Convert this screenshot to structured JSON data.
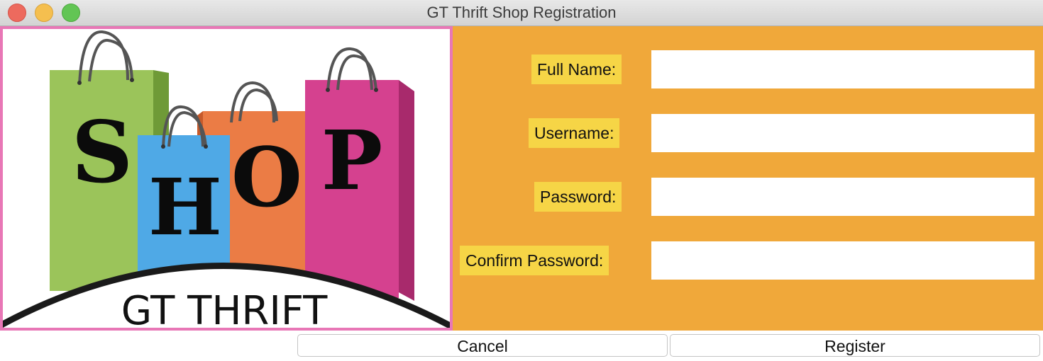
{
  "window": {
    "title": "GT Thrift Shop Registration"
  },
  "logo": {
    "bag_letters": [
      "S",
      "H",
      "O",
      "P"
    ],
    "caption": "GT THRIFT",
    "colors": {
      "border": "#e877b6",
      "bag_green": "#9bc45a",
      "bag_blue": "#4fa9e6",
      "bag_orange": "#eb7c45",
      "bag_pink": "#d5418f"
    }
  },
  "form": {
    "fields": [
      {
        "label": "Full Name:",
        "value": "",
        "placeholder": ""
      },
      {
        "label": "Username:",
        "value": "",
        "placeholder": ""
      },
      {
        "label": "Password:",
        "value": "",
        "placeholder": ""
      },
      {
        "label": "Confirm Password:",
        "value": "",
        "placeholder": ""
      }
    ],
    "colors": {
      "background": "#f0a83a",
      "label_background": "#f6d546"
    }
  },
  "buttons": {
    "cancel": "Cancel",
    "register": "Register"
  }
}
